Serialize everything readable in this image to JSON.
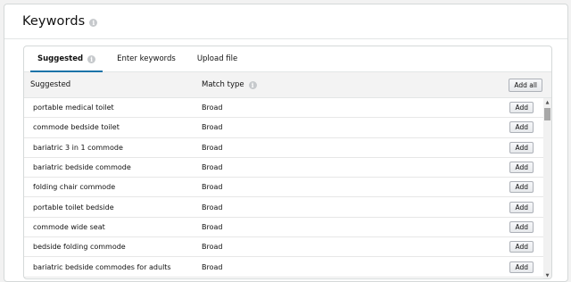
{
  "header": {
    "title": "Keywords",
    "info_icon": "info-icon"
  },
  "tabs": [
    {
      "label": "Suggested",
      "active": true
    },
    {
      "label": "Enter keywords",
      "active": false
    },
    {
      "label": "Upload file",
      "active": false
    }
  ],
  "table": {
    "columns": {
      "keyword": "Suggested",
      "match_type": "Match type"
    },
    "add_all_label": "Add all",
    "add_label": "Add",
    "rows": [
      {
        "keyword": "portable medical toilet",
        "match_type": "Broad"
      },
      {
        "keyword": "commode bedside toilet",
        "match_type": "Broad"
      },
      {
        "keyword": "bariatric 3 in 1 commode",
        "match_type": "Broad"
      },
      {
        "keyword": "bariatric bedside commode",
        "match_type": "Broad"
      },
      {
        "keyword": "folding chair commode",
        "match_type": "Broad"
      },
      {
        "keyword": "portable toilet bedside",
        "match_type": "Broad"
      },
      {
        "keyword": "commode wide seat",
        "match_type": "Broad"
      },
      {
        "keyword": "bedside folding commode",
        "match_type": "Broad"
      },
      {
        "keyword": "bariatric bedside commodes for adults",
        "match_type": "Broad"
      }
    ]
  },
  "colors": {
    "accent": "#1a73a8",
    "header_bg": "#f3f3f3",
    "border": "#d5d9d9"
  }
}
